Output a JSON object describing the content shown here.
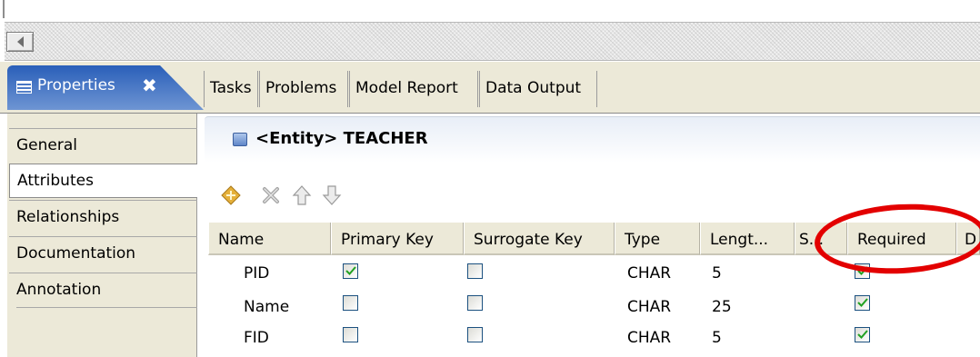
{
  "tabs": {
    "active": "Properties",
    "close_glyph": "✖",
    "others": [
      "Tasks",
      "Problems",
      "Model Report",
      "Data Output"
    ]
  },
  "side_tabs": [
    "General",
    "Attributes",
    "Relationships",
    "Documentation",
    "Annotation"
  ],
  "selected_side_tab": "Attributes",
  "header": {
    "kind": "<Entity>",
    "name": "TEACHER"
  },
  "toolbar_icons": [
    "add-icon",
    "delete-icon",
    "move-up-icon",
    "move-down-icon"
  ],
  "table": {
    "columns": [
      "Name",
      "Primary Key",
      "Surrogate Key",
      "Type",
      "Lengt...",
      "S...",
      "Required",
      "D"
    ],
    "rows": [
      {
        "name": "PID",
        "primary_key": true,
        "surrogate_key": false,
        "type": "CHAR",
        "length": "5",
        "required": true
      },
      {
        "name": "Name",
        "primary_key": false,
        "surrogate_key": false,
        "type": "CHAR",
        "length": "25",
        "required": true
      },
      {
        "name": "FID",
        "primary_key": false,
        "surrogate_key": false,
        "type": "CHAR",
        "length": "5",
        "required": true
      }
    ]
  },
  "colors": {
    "highlight_ellipse": "#e30000",
    "active_tab": "#2a5fb9",
    "checkbox_border": "#1c5180",
    "checkmark": "#21a121"
  }
}
